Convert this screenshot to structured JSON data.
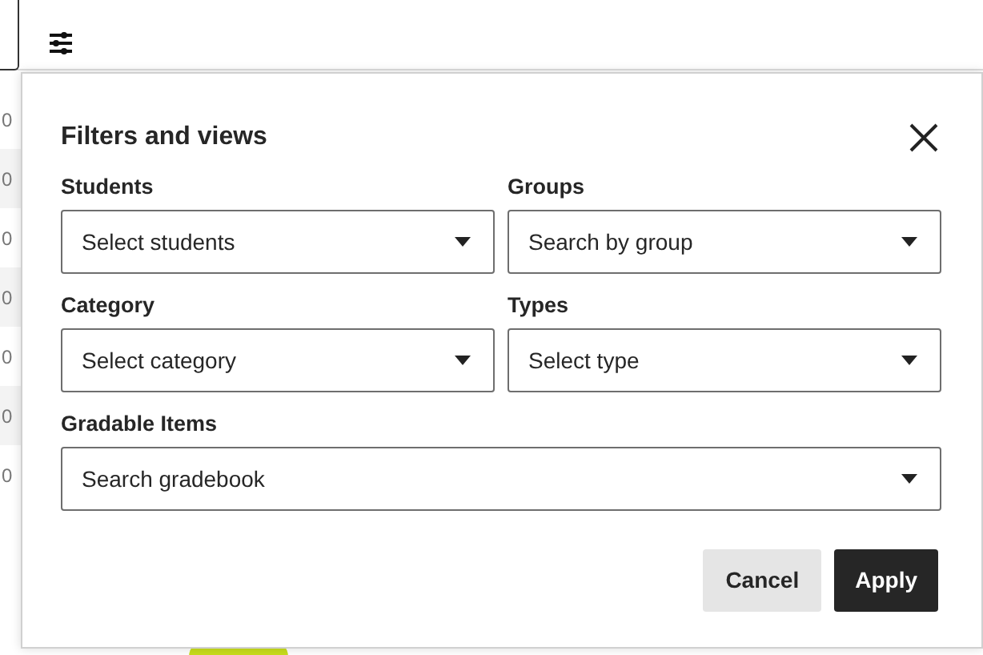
{
  "background_table": {
    "rows": [
      {
        "column_1": "0",
        "striped": false
      },
      {
        "column_1": "0",
        "striped": true
      },
      {
        "column_1": "0",
        "striped": false
      },
      {
        "column_1": "0",
        "striped": true
      },
      {
        "column_1": "0",
        "striped": false
      },
      {
        "column_1": "0",
        "striped": true
      },
      {
        "column_1": "0",
        "striped": false
      }
    ]
  },
  "dialog": {
    "title": "Filters and views",
    "fields": [
      {
        "label": "Students",
        "placeholder": "Select students"
      },
      {
        "label": "Groups",
        "placeholder": "Search by group"
      },
      {
        "label": "Category",
        "placeholder": "Select category"
      },
      {
        "label": "Types",
        "placeholder": "Select type"
      },
      {
        "label": "Gradable Items",
        "placeholder": "Search gradebook"
      }
    ],
    "buttons": [
      {
        "label": "Cancel",
        "kind": "secondary"
      },
      {
        "label": "Apply",
        "kind": "primary"
      }
    ]
  }
}
